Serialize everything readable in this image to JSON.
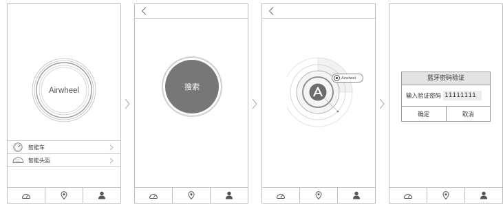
{
  "brand": {
    "logo_text": "Airwheel"
  },
  "device_list": [
    {
      "label": "智能车",
      "icon": "speedometer-icon"
    },
    {
      "label": "智能头盔",
      "icon": "helmet-icon"
    }
  ],
  "tabbar": [
    {
      "icon": "speedometer-icon"
    },
    {
      "icon": "location-pin-icon"
    },
    {
      "icon": "user-icon"
    }
  ],
  "search": {
    "button_label": "搜索"
  },
  "scan": {
    "found_device_label": "Airwheel"
  },
  "pair_dialog": {
    "title": "蓝牙密码验证",
    "input_label": "输入验证密码",
    "input_value": "11111111",
    "confirm_label": "确定",
    "cancel_label": "取消"
  },
  "colors": {
    "line": "#bfbfbf",
    "accent_gray": "#777777",
    "dialog_header": "#e3e3e3"
  }
}
